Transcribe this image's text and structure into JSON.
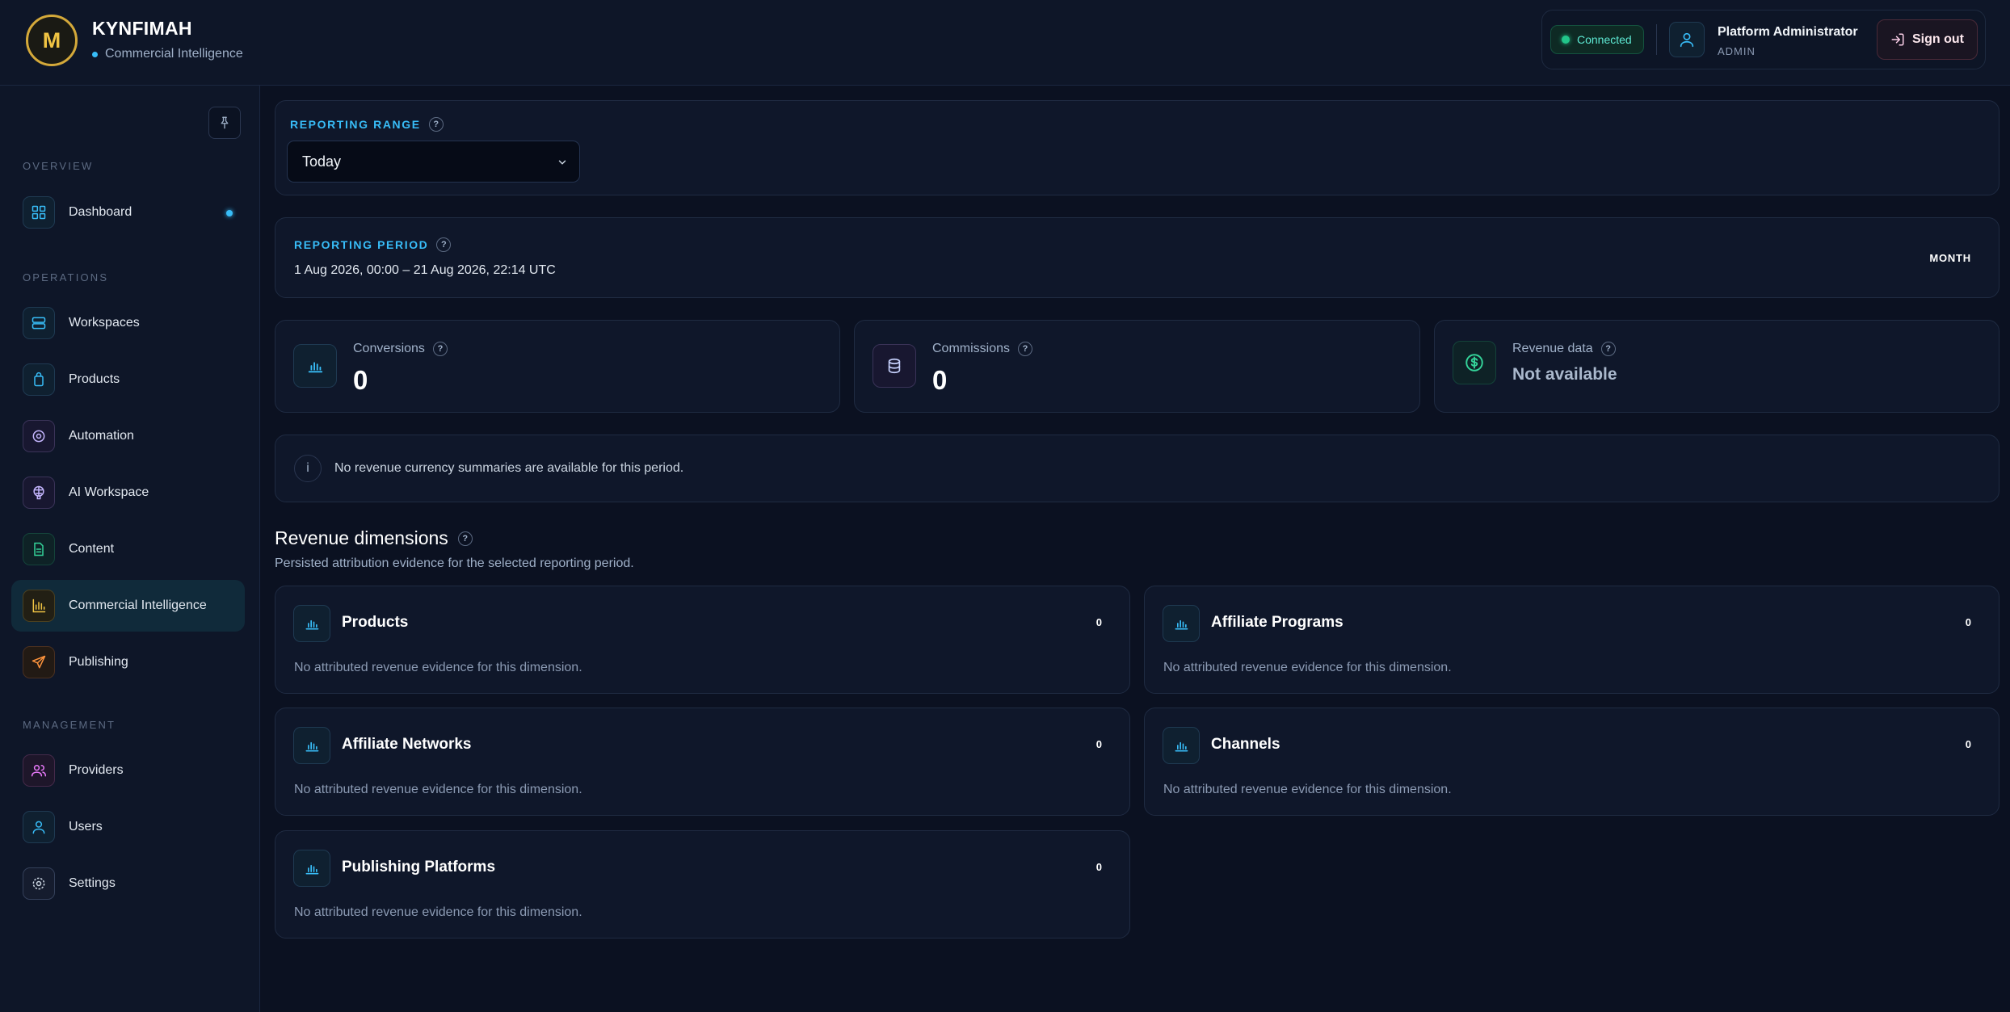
{
  "brand": {
    "initial": "M",
    "name": "KYNFIMAH",
    "subtitle": "Commercial Intelligence"
  },
  "header": {
    "status": "Connected",
    "user_name": "Platform Administrator",
    "user_role": "ADMIN",
    "sign_out": "Sign out"
  },
  "sidebar": {
    "sections": {
      "overview": "OVERVIEW",
      "operations": "OPERATIONS",
      "management": "MANAGEMENT"
    },
    "items": [
      {
        "label": "Dashboard",
        "icon": "dashboard-grid-icon"
      },
      {
        "label": "Workspaces",
        "icon": "server-stack-icon"
      },
      {
        "label": "Products",
        "icon": "shopping-bag-icon"
      },
      {
        "label": "Automation",
        "icon": "automation-circle-icon"
      },
      {
        "label": "AI Workspace",
        "icon": "ai-brain-icon"
      },
      {
        "label": "Content",
        "icon": "document-icon"
      },
      {
        "label": "Commercial Intelligence",
        "icon": "bar-chart-icon",
        "active": true
      },
      {
        "label": "Publishing",
        "icon": "send-icon"
      },
      {
        "label": "Providers",
        "icon": "users-icon"
      },
      {
        "label": "Users",
        "icon": "user-icon"
      },
      {
        "label": "Settings",
        "icon": "settings-gear-icon"
      }
    ]
  },
  "reporting_range": {
    "label": "REPORTING RANGE",
    "selected": "Today"
  },
  "reporting_period": {
    "label": "REPORTING PERIOD",
    "range": "1 Aug 2026, 00:00 – 21 Aug 2026, 22:14 UTC",
    "granularity": "MONTH"
  },
  "kpis": [
    {
      "label": "Conversions",
      "value": "0",
      "icon": "bar-chart-icon",
      "color": "#38bdf8"
    },
    {
      "label": "Commissions",
      "value": "0",
      "icon": "database-icon",
      "color": "#a5b4fc"
    },
    {
      "label": "Revenue data",
      "value": "Not available",
      "icon": "dollar-circle-icon",
      "color": "#34d399"
    }
  ],
  "info_notice": {
    "icon": "i",
    "text": "No revenue currency summaries are available for this period."
  },
  "revenue_dimensions": {
    "title": "Revenue dimensions",
    "subtitle": "Persisted attribution evidence for the selected reporting period.",
    "items": [
      {
        "title": "Products",
        "count": "0",
        "empty": "No attributed revenue evidence for this dimension."
      },
      {
        "title": "Affiliate Programs",
        "count": "0",
        "empty": "No attributed revenue evidence for this dimension."
      },
      {
        "title": "Affiliate Networks",
        "count": "0",
        "empty": "No attributed revenue evidence for this dimension."
      },
      {
        "title": "Channels",
        "count": "0",
        "empty": "No attributed revenue evidence for this dimension."
      },
      {
        "title": "Publishing Platforms",
        "count": "0",
        "empty": "No attributed revenue evidence for this dimension."
      }
    ]
  },
  "colors": {
    "accent": "#38bdf8",
    "background": "#0b1121",
    "success": "#22c58a",
    "brand": "#f0c443"
  }
}
